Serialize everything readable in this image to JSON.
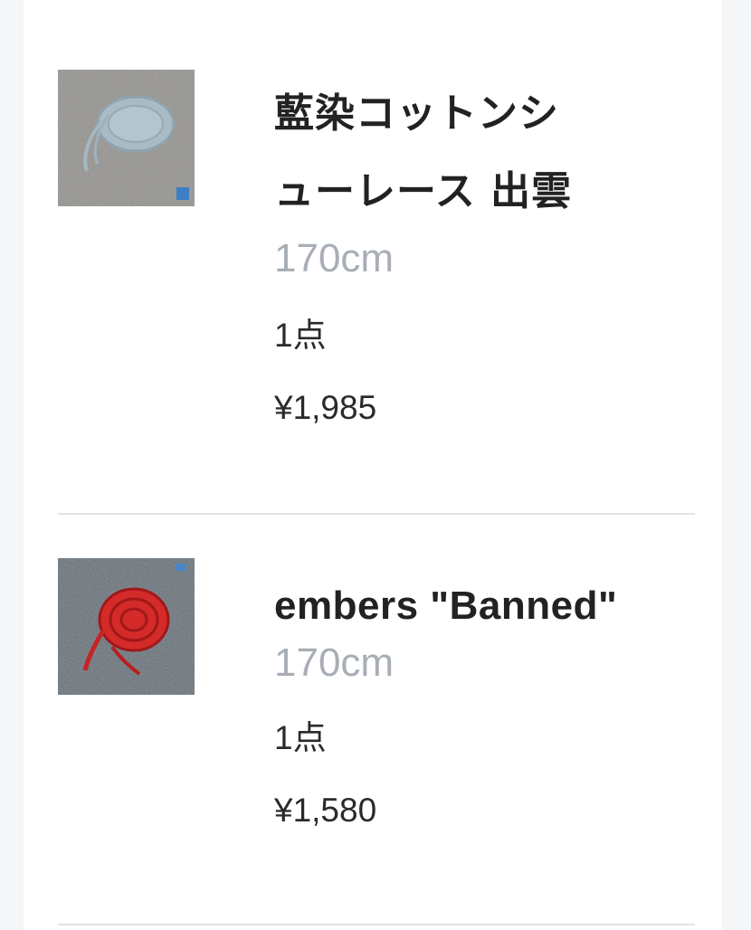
{
  "items": [
    {
      "title_line1": "藍染コットンシ",
      "title_line2": "ューレース 出雲",
      "length": "170cm",
      "quantity": "1点",
      "price": "¥1,985",
      "thumb_color": "#9fb3bf"
    },
    {
      "title": "embers \"Banned\"",
      "length": "170cm",
      "quantity": "1点",
      "price": "¥1,580",
      "thumb_color": "#d42a2a"
    }
  ]
}
